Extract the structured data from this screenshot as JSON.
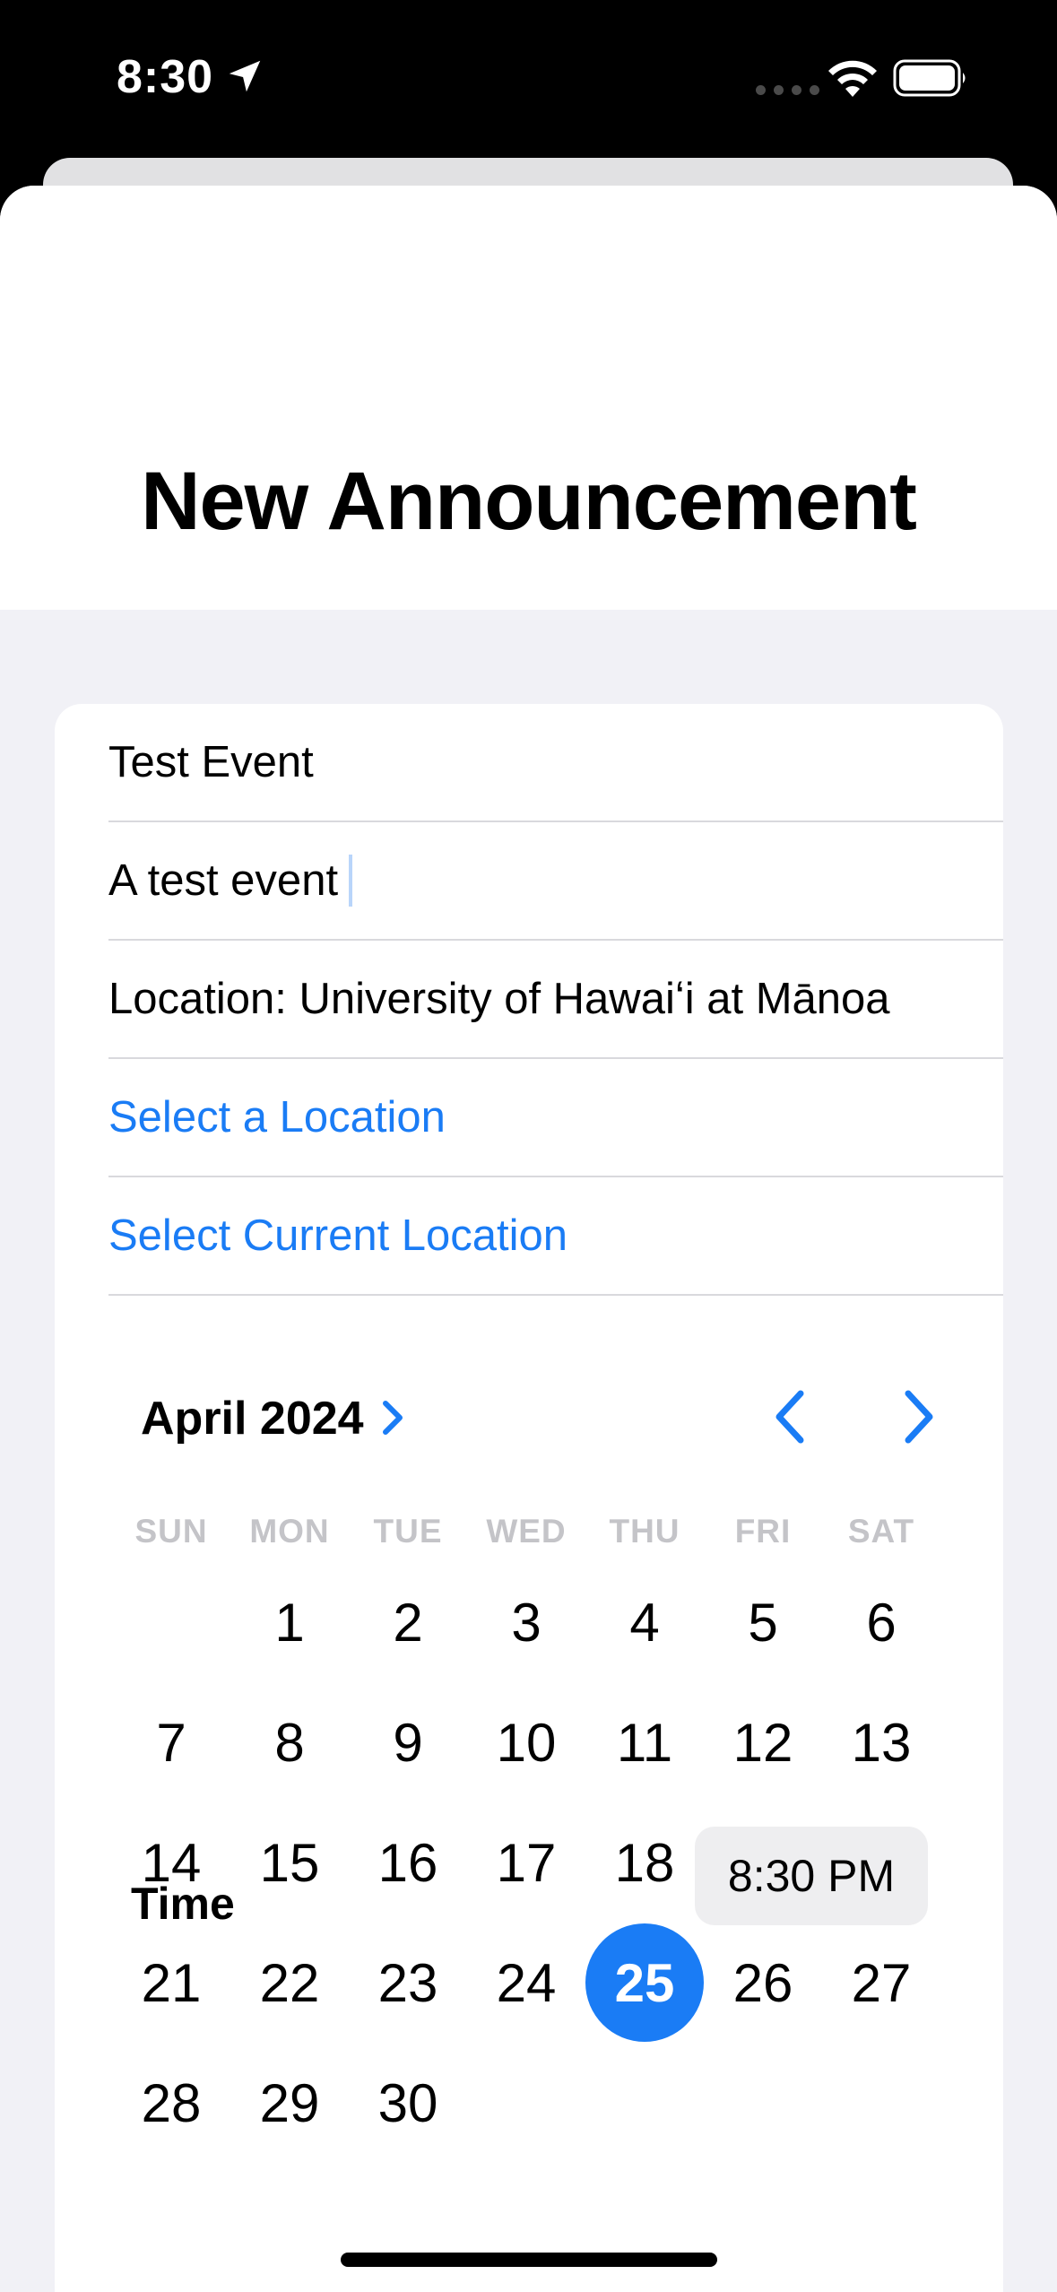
{
  "status_bar": {
    "time": "8:30",
    "icons": [
      "location-arrow-icon",
      "cellular-dots-icon",
      "wifi-icon",
      "battery-icon"
    ]
  },
  "header": {
    "title": "New Announcement"
  },
  "form": {
    "title_value": "Test Event",
    "description_value": "A test event",
    "location_text": "Location: University of Hawaiʻi at Mānoa",
    "select_location_label": "Select a Location",
    "select_current_location_label": "Select Current Location"
  },
  "calendar": {
    "month_label": "April 2024",
    "weekdays": [
      "SUN",
      "MON",
      "TUE",
      "WED",
      "THU",
      "FRI",
      "SAT"
    ],
    "leading_blank_days": 1,
    "days_in_month": 30,
    "selected_day": 25,
    "time_label": "Time",
    "time_value": "8:30 PM"
  },
  "colors": {
    "accent": "#1a7cf5",
    "sheet_background": "#f1f1f6",
    "card_background": "#ffffff",
    "weekday_text": "#c4c4c8"
  }
}
